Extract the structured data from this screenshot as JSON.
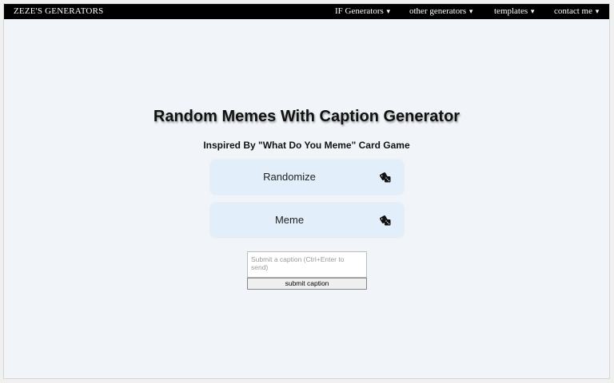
{
  "navbar": {
    "brand": "ZEZE'S GENERATORS",
    "items": [
      {
        "label": "IF Generators",
        "caret": "▾"
      },
      {
        "label": "other generators",
        "caret": "▾"
      },
      {
        "label": "templates",
        "caret": "▾"
      },
      {
        "label": "contact me",
        "caret": "▾"
      }
    ]
  },
  "main": {
    "title": "Random Memes With Caption Generator",
    "subtitle": "Inspired By \"What Do You Meme\" Card Game",
    "buttons": [
      {
        "label": "Randomize",
        "icon": "dice-icon"
      },
      {
        "label": "Meme",
        "icon": "dice-icon"
      }
    ]
  },
  "caption_form": {
    "placeholder": "Submit a caption (Ctrl+Enter to send)",
    "value": "",
    "submit_label": "submit caption"
  },
  "colors": {
    "navbar_bg": "#000000",
    "page_bg": "#f1f5f9",
    "button_bg": "#e2eefa"
  }
}
